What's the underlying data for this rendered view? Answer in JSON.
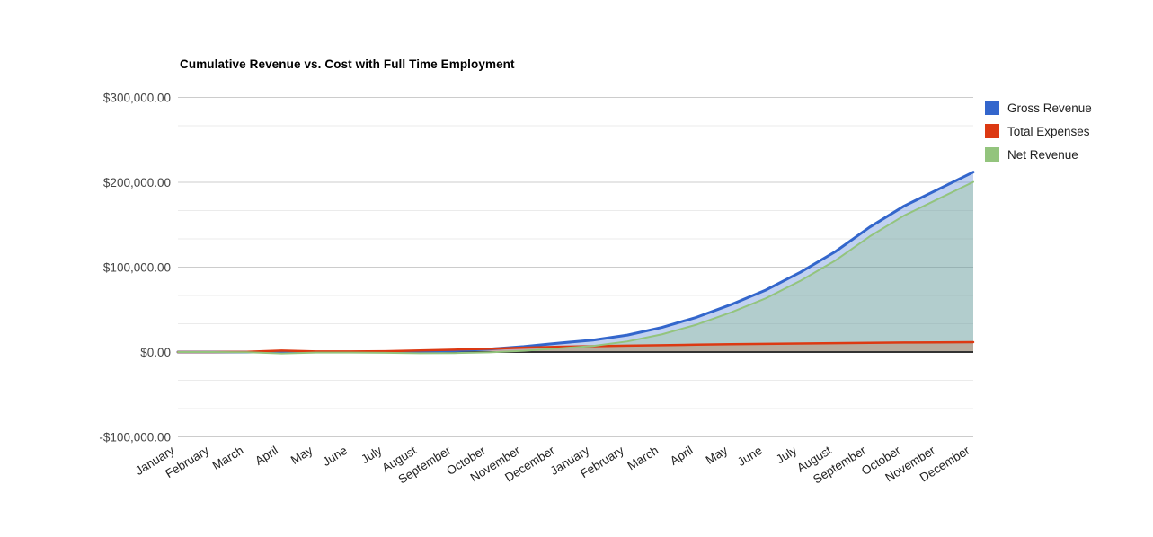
{
  "chart_data": {
    "type": "area",
    "title": "Cumulative Revenue vs. Cost with Full Time Employment",
    "legend_position": "right",
    "grid": true,
    "categories": [
      "January",
      "February",
      "March",
      "April",
      "May",
      "June",
      "July",
      "August",
      "September",
      "October",
      "November",
      "December",
      "January",
      "February",
      "March",
      "April",
      "May",
      "June",
      "July",
      "August",
      "September",
      "October",
      "November",
      "December"
    ],
    "series": [
      {
        "name": "Gross Revenue",
        "color": "#3366CC",
        "fill_opacity": 0.3,
        "line_width": 3,
        "values": [
          0,
          0,
          0,
          0,
          0,
          0,
          0,
          400,
          1500,
          3500,
          6500,
          10500,
          14000,
          20000,
          29000,
          41000,
          56000,
          73000,
          94000,
          118000,
          147000,
          172000,
          192000,
          212000
        ]
      },
      {
        "name": "Total Expenses",
        "color": "#DC3912",
        "fill_opacity": 0.3,
        "line_width": 2.5,
        "values": [
          0,
          0,
          200,
          1700,
          700,
          700,
          900,
          1900,
          2800,
          3900,
          5100,
          6200,
          6900,
          7500,
          8100,
          8700,
          9200,
          9700,
          10100,
          10500,
          10900,
          11200,
          11400,
          11600
        ]
      },
      {
        "name": "Net Revenue",
        "color": "#93C47D",
        "fill_opacity": 0.3,
        "line_width": 2,
        "values": [
          0,
          0,
          -200,
          -1700,
          -700,
          -700,
          -900,
          -1500,
          -1300,
          -400,
          1400,
          4300,
          7100,
          12500,
          20900,
          32300,
          46800,
          63300,
          83900,
          107500,
          136100,
          160800,
          180600,
          200400
        ]
      }
    ],
    "y_axis": {
      "min": -100000,
      "max": 300000,
      "major_step": 100000,
      "minor_step": 33333.33,
      "ticks": [
        {
          "label": "$300,000.00",
          "value": 300000
        },
        {
          "label": "$200,000.00",
          "value": 200000
        },
        {
          "label": "$100,000.00",
          "value": 100000
        },
        {
          "label": "$0.00",
          "value": 0
        },
        {
          "label": "-$100,000.00",
          "value": -100000
        }
      ]
    },
    "colors": {
      "major_gridline": "#cccccc",
      "minor_gridline": "#ebebeb",
      "baseline": "#333333",
      "axis_text": "#444444",
      "category_text": "#222222",
      "title_text": "#000000"
    }
  }
}
